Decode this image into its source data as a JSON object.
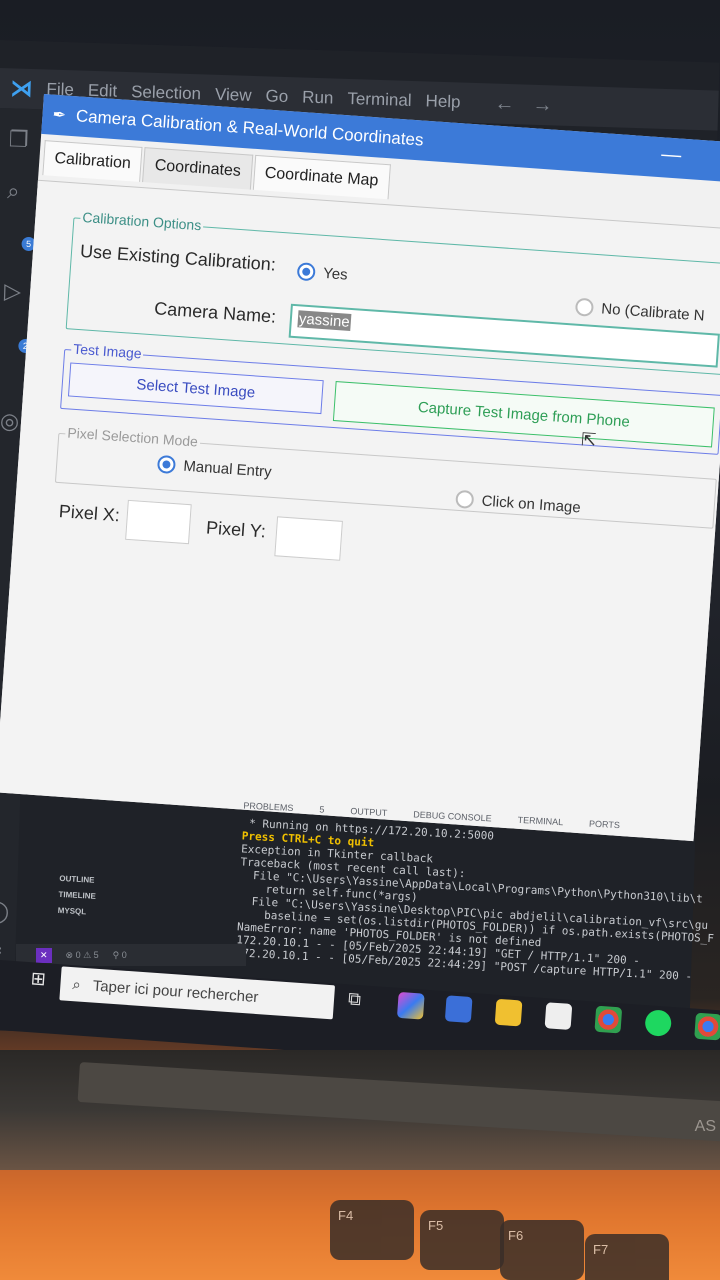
{
  "vscode": {
    "menu": [
      "File",
      "Edit",
      "Selection",
      "View",
      "Go",
      "Run",
      "Terminal",
      "Help"
    ],
    "activity_badges": [
      "5",
      "2"
    ],
    "outline": [
      "OUTLINE",
      "TIMELINE",
      "MYSQL"
    ],
    "status_bar": {
      "remote": "",
      "problems": "⊗ 0 ⚠ 5",
      "ports": "⚲ 0"
    }
  },
  "window": {
    "title": "Camera Calibration & Real-World Coordinates",
    "tabs": [
      "Calibration",
      "Coordinates",
      "Coordinate Map"
    ],
    "calibration_options": {
      "legend": "Calibration Options",
      "use_existing_label": "Use Existing Calibration:",
      "yes_label": "Yes",
      "no_label": "No (Calibrate N",
      "selected": "yes",
      "camera_name_label": "Camera Name:",
      "camera_name_value": "yassine"
    },
    "test_image": {
      "legend": "Test Image",
      "select_button": "Select Test Image",
      "capture_button": "Capture Test Image from Phone"
    },
    "pixel_selection": {
      "legend": "Pixel Selection Mode",
      "manual_label": "Manual Entry",
      "click_label": "Click on Image",
      "selected": "manual"
    },
    "pixel_x_label": "Pixel X:",
    "pixel_y_label": "Pixel Y:"
  },
  "panel": {
    "tabs": [
      "PROBLEMS",
      "5",
      "OUTPUT",
      "DEBUG CONSOLE",
      "TERMINAL",
      "PORTS"
    ],
    "terminal_lines": [
      " * Running on https://172.20.10.2:5000",
      "Press CTRL+C to quit",
      "Exception in Tkinter callback",
      "Traceback (most recent call last):",
      "  File \"C:\\Users\\Yassine\\AppData\\Local\\Programs\\Python\\Python310\\lib\\t",
      "    return self.func(*args)",
      "  File \"C:\\Users\\Yassine\\Desktop\\PIC\\pic abdjelil\\calibration_vf\\src\\gu",
      "    baseline = set(os.listdir(PHOTOS_FOLDER)) if os.path.exists(PHOTOS_F",
      "NameError: name 'PHOTOS_FOLDER' is not defined",
      "172.20.10.1 - - [05/Feb/2025 22:44:19] \"GET / HTTP/1.1\" 200 -",
      "172.20.10.1 - - [05/Feb/2025 22:44:29] \"POST /capture HTTP/1.1\" 200 -"
    ]
  },
  "taskbar": {
    "search_placeholder": "Taper ici pour rechercher"
  },
  "laptop": {
    "brand": "AS",
    "keys": [
      "F4",
      "F5",
      "F6",
      "F7"
    ]
  }
}
